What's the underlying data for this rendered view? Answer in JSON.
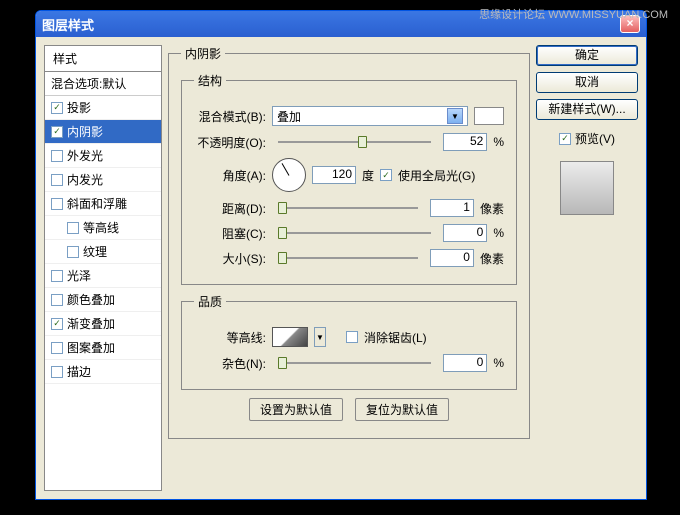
{
  "watermark": "思缘设计论坛  WWW.MISSYUAN.COM",
  "window": {
    "title": "图层样式",
    "close": "×"
  },
  "styles_panel": {
    "header": "样式",
    "blend": "混合选项:默认",
    "items": [
      {
        "label": "投影",
        "checked": true,
        "selected": false
      },
      {
        "label": "内阴影",
        "checked": true,
        "selected": true
      },
      {
        "label": "外发光",
        "checked": false,
        "selected": false
      },
      {
        "label": "内发光",
        "checked": false,
        "selected": false
      },
      {
        "label": "斜面和浮雕",
        "checked": false,
        "selected": false
      },
      {
        "label": "等高线",
        "checked": false,
        "selected": false,
        "indent": true
      },
      {
        "label": "纹理",
        "checked": false,
        "selected": false,
        "indent": true
      },
      {
        "label": "光泽",
        "checked": false,
        "selected": false
      },
      {
        "label": "颜色叠加",
        "checked": false,
        "selected": false
      },
      {
        "label": "渐变叠加",
        "checked": true,
        "selected": false
      },
      {
        "label": "图案叠加",
        "checked": false,
        "selected": false
      },
      {
        "label": "描边",
        "checked": false,
        "selected": false
      }
    ]
  },
  "inner_shadow": {
    "title": "内阴影",
    "structure": {
      "legend": "结构",
      "blend_mode_label": "混合模式(B):",
      "blend_mode_value": "叠加",
      "opacity_label": "不透明度(O):",
      "opacity_value": "52",
      "opacity_unit": "%",
      "angle_label": "角度(A):",
      "angle_value": "120",
      "angle_unit": "度",
      "global_light_label": "使用全局光(G)",
      "distance_label": "距离(D):",
      "distance_value": "1",
      "distance_unit": "像素",
      "choke_label": "阻塞(C):",
      "choke_value": "0",
      "choke_unit": "%",
      "size_label": "大小(S):",
      "size_value": "0",
      "size_unit": "像素"
    },
    "quality": {
      "legend": "品质",
      "contour_label": "等高线:",
      "antialias_label": "消除锯齿(L)",
      "noise_label": "杂色(N):",
      "noise_value": "0",
      "noise_unit": "%"
    },
    "buttons": {
      "set_default": "设置为默认值",
      "reset_default": "复位为默认值"
    }
  },
  "right": {
    "ok": "确定",
    "cancel": "取消",
    "new_style": "新建样式(W)...",
    "preview": "预览(V)"
  }
}
